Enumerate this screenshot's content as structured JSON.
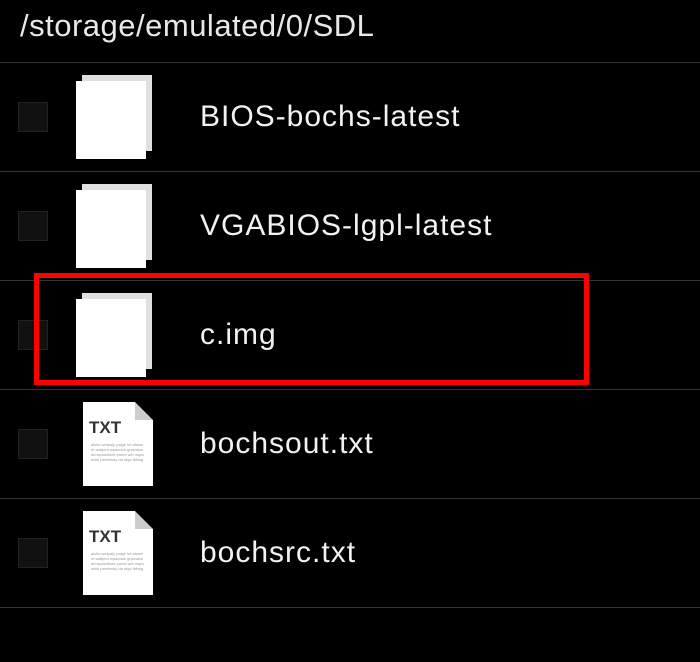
{
  "path": "/storage/emulated/0/SDL",
  "files": [
    {
      "name": "BIOS-bochs-latest",
      "type": "blank"
    },
    {
      "name": "VGABIOS-lgpl-latest",
      "type": "blank"
    },
    {
      "name": "c.img",
      "type": "blank"
    },
    {
      "name": "bochsout.txt",
      "type": "txt"
    },
    {
      "name": "bochsrc.txt",
      "type": "txt"
    }
  ],
  "highlighted_index": 2,
  "txt_badge": "TXT"
}
